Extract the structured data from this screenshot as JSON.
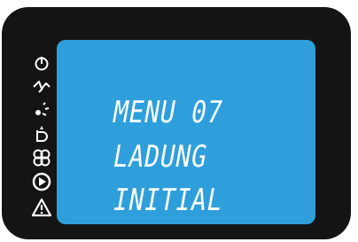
{
  "display": {
    "line1": "MENU 07",
    "line2": "LADUNG",
    "line3": "INITIAL"
  },
  "icons": [
    "power-icon",
    "lightning-icon",
    "sun-icon",
    "boiler-icon",
    "fan-icon",
    "play-icon",
    "warning-icon"
  ],
  "colors": {
    "bezel": "#141414",
    "screen": "#2f9fdc",
    "text": "#ffffff"
  }
}
